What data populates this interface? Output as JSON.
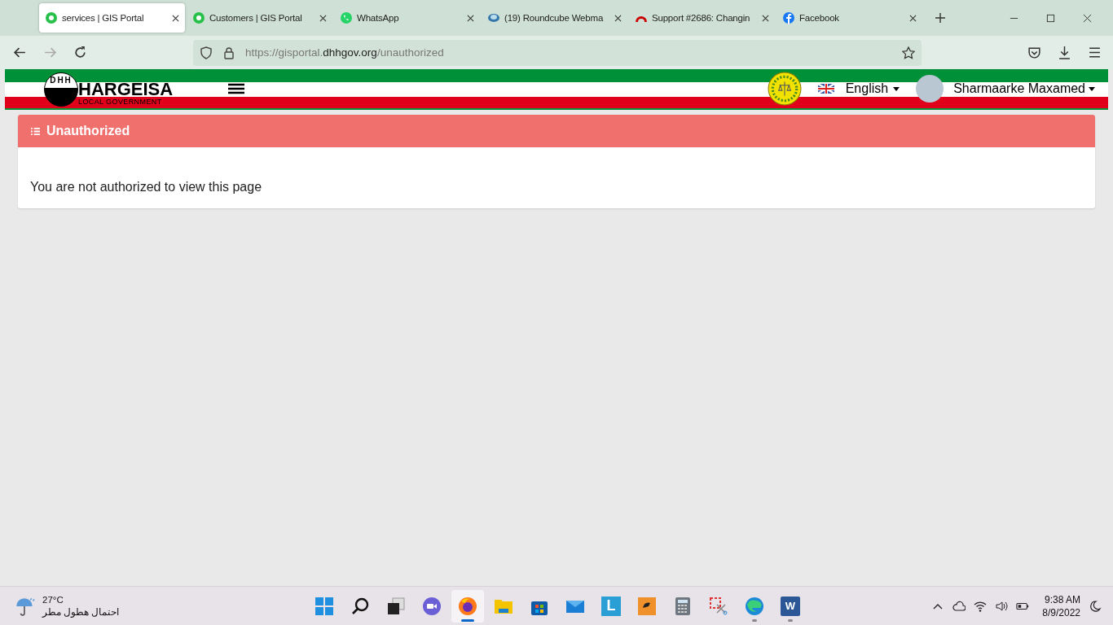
{
  "browser": {
    "tabs": [
      {
        "title": "services | GIS Portal",
        "kind": "portal",
        "selected": true
      },
      {
        "title": "Customers | GIS Portal",
        "kind": "portal",
        "selected": false
      },
      {
        "title": "WhatsApp",
        "kind": "whatsapp",
        "selected": false
      },
      {
        "title": "(19) Roundcube Webma",
        "kind": "roundcube",
        "selected": false
      },
      {
        "title": "Support #2686: Changin",
        "kind": "redmine",
        "selected": false
      },
      {
        "title": "Facebook",
        "kind": "facebook",
        "selected": false
      }
    ],
    "url": {
      "host_prefix": "https://gisportal.",
      "host": "dhhgov.org",
      "path": "/unauthorized"
    }
  },
  "header": {
    "logo_mark": "DHH",
    "logo_title": "HARGEISA",
    "logo_subtitle": "LOCAL GOVERNMENT",
    "language": "English",
    "user": "Sharmaarke Maxamed"
  },
  "card": {
    "title": "Unauthorized",
    "message": "You are not authorized to view this page"
  },
  "taskbar": {
    "weather": {
      "temperature": "27°C",
      "condition": "احتمال هطول مطر"
    },
    "apps": [
      {
        "kind": "start",
        "running": false,
        "selected": false
      },
      {
        "kind": "search",
        "running": false,
        "selected": false
      },
      {
        "kind": "taskview",
        "running": false,
        "selected": false
      },
      {
        "kind": "chat",
        "running": false,
        "selected": false
      },
      {
        "kind": "firefox",
        "running": true,
        "selected": true
      },
      {
        "kind": "folder",
        "running": false,
        "selected": false
      },
      {
        "kind": "store",
        "running": false,
        "selected": false
      },
      {
        "kind": "mail",
        "running": false,
        "selected": false
      },
      {
        "kind": "tile",
        "label": "L",
        "running": false,
        "selected": false
      },
      {
        "kind": "orange",
        "running": false,
        "selected": false
      },
      {
        "kind": "calculator",
        "running": false,
        "selected": false
      },
      {
        "kind": "snip",
        "running": false,
        "selected": false
      },
      {
        "kind": "edge",
        "running": true,
        "selected": false
      },
      {
        "kind": "word",
        "label": "W",
        "running": true,
        "selected": false
      }
    ],
    "time": "9:38 AM",
    "date": "8/9/2022"
  }
}
